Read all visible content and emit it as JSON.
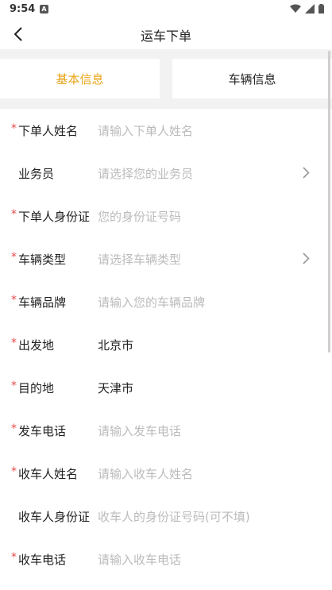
{
  "status": {
    "time": "9:54",
    "notif": "A"
  },
  "nav": {
    "title": "运车下单"
  },
  "tabs": [
    {
      "label": "基本信息",
      "active": true
    },
    {
      "label": "车辆信息",
      "active": false
    }
  ],
  "colors": {
    "accent": "#e8a419",
    "required": "#e84a4a",
    "placeholder": "#bbbbbb",
    "background": "#f2f2f2"
  },
  "form": {
    "fields": [
      {
        "label": "下单人姓名",
        "required": true,
        "value": "",
        "placeholder": "请输入下单人姓名",
        "chevron": false
      },
      {
        "label": "业务员",
        "required": false,
        "value": "",
        "placeholder": "请选择您的业务员",
        "chevron": true
      },
      {
        "label": "下单人身份证",
        "required": true,
        "value": "",
        "placeholder": "您的身份证号码",
        "chevron": false
      },
      {
        "label": "车辆类型",
        "required": true,
        "value": "",
        "placeholder": "请选择车辆类型",
        "chevron": true
      },
      {
        "label": "车辆品牌",
        "required": true,
        "value": "",
        "placeholder": "请输入您的车辆品牌",
        "chevron": false
      },
      {
        "label": "出发地",
        "required": true,
        "value": "北京市",
        "placeholder": "",
        "chevron": false
      },
      {
        "label": "目的地",
        "required": true,
        "value": "天津市",
        "placeholder": "",
        "chevron": false
      },
      {
        "label": "发车电话",
        "required": true,
        "value": "",
        "placeholder": "请输入发车电话",
        "chevron": false
      },
      {
        "label": "收车人姓名",
        "required": true,
        "value": "",
        "placeholder": "请输入收车人姓名",
        "chevron": false
      },
      {
        "label": "收车人身份证",
        "required": false,
        "value": "",
        "placeholder": "收车人的身份证号码(可不填)",
        "chevron": false
      },
      {
        "label": "收车电话",
        "required": true,
        "value": "",
        "placeholder": "请输入收车电话",
        "chevron": false
      }
    ]
  }
}
